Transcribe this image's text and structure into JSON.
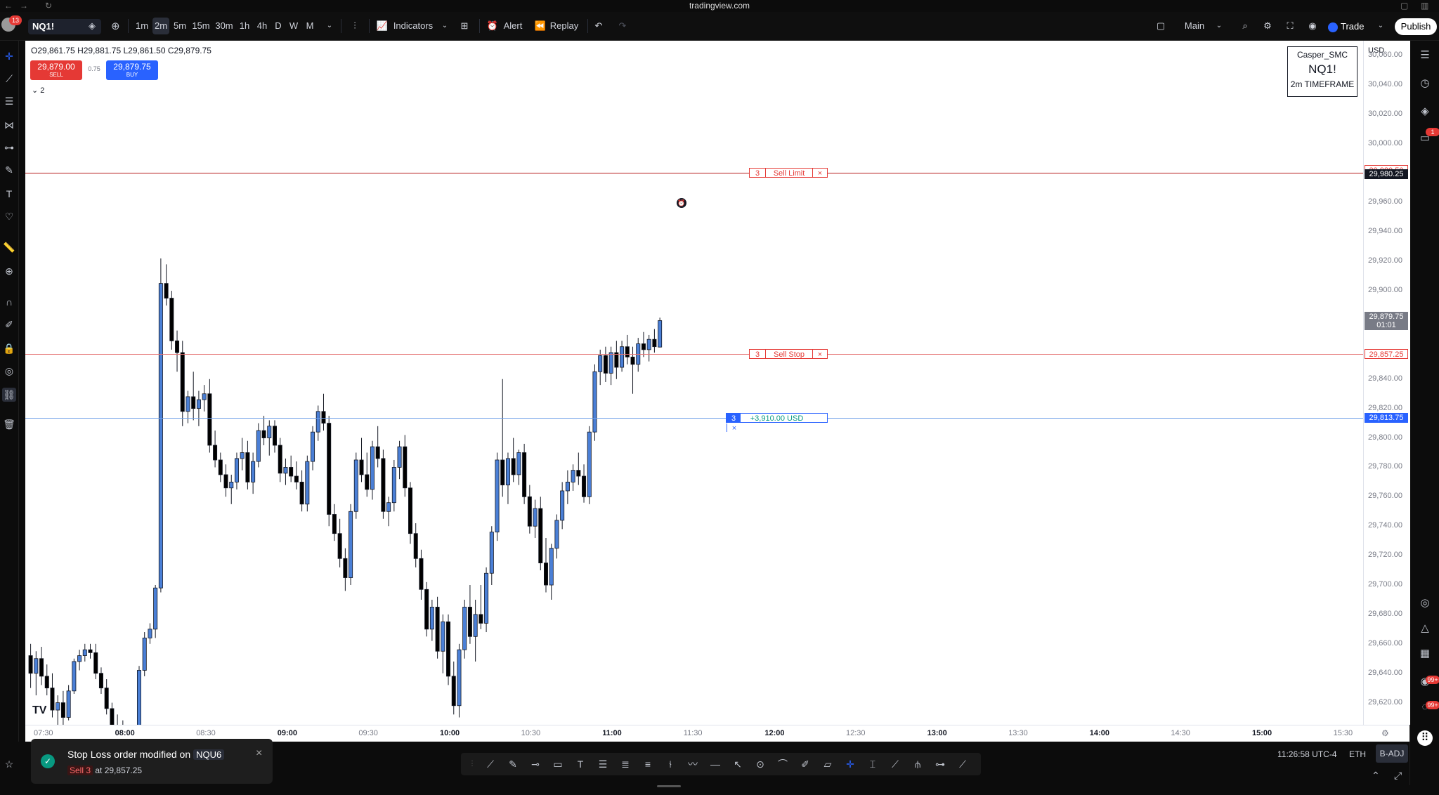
{
  "browser": {
    "url": "tradingview.com"
  },
  "toolbar": {
    "avatar_badge": "13",
    "symbol": "NQ1!",
    "intervals": [
      "1m",
      "2m",
      "5m",
      "15m",
      "30m",
      "1h",
      "4h",
      "D",
      "W",
      "M"
    ],
    "active_interval": "2m",
    "indicators_label": "Indicators",
    "alert_label": "Alert",
    "replay_label": "Replay",
    "layout_label": "Main",
    "trade_label": "Trade",
    "publish_label": "Publish"
  },
  "legend": {
    "open": "O29,861.75",
    "high": "H29,881.75",
    "low": "L29,861.50",
    "close": "C29,879.75",
    "sell_price": "29,879.00",
    "sell_label": "SELL",
    "spread": "0.75",
    "buy_price": "29,879.75",
    "buy_label": "BUY",
    "collapse_count": "2"
  },
  "info_box": {
    "user": "Casper_SMC",
    "symbol": "NQ1!",
    "timeframe": "2m TIMEFRAME"
  },
  "currency": "USD",
  "orders": {
    "sell_limit": {
      "qty": "3",
      "label": "Sell Limit",
      "price": 29980.5,
      "price_label": "29,980.50"
    },
    "sell_stop": {
      "qty": "3",
      "label": "Sell Stop",
      "price": 29857.25,
      "price_label": "29,857.25"
    },
    "position": {
      "qty": "3",
      "pnl": "+3,910.00 USD",
      "price": 29813.75,
      "price_label": "29,813.75"
    },
    "alert_line_price": 29980.25,
    "alert_line_label": "29,980.25",
    "last_price": 29879.75,
    "last_price_label": "29,879.75",
    "countdown": "01:01"
  },
  "chart_data": {
    "type": "candlestick",
    "y_axis": {
      "min": 29620,
      "max": 30060,
      "ticks": [
        30060,
        30040,
        30020,
        30000,
        29960,
        29940,
        29920,
        29900,
        29840,
        29820,
        29800,
        29780,
        29760,
        29740,
        29720,
        29700,
        29680,
        29660,
        29640,
        29620
      ],
      "tick_labels": [
        "30,060.00",
        "30,040.00",
        "30,020.00",
        "30,000.00",
        "29,960.00",
        "29,940.00",
        "29,920.00",
        "29,900.00",
        "29,840.00",
        "29,820.00",
        "29,800.00",
        "29,780.00",
        "29,760.00",
        "29,740.00",
        "29,720.00",
        "29,700.00",
        "29,680.00",
        "29,660.00",
        "29,640.00",
        "29,620.00"
      ]
    },
    "x_axis": {
      "labels": [
        "07:30",
        "08:00",
        "08:30",
        "09:00",
        "09:30",
        "10:00",
        "10:30",
        "11:00",
        "11:30",
        "12:00",
        "12:30",
        "13:00",
        "13:30",
        "14:00",
        "14:30",
        "15:00",
        "15:30"
      ],
      "major": [
        "08:00",
        "09:00",
        "10:00",
        "11:00",
        "12:00",
        "13:00",
        "14:00",
        "15:00"
      ]
    },
    "candles": [
      {
        "o": 29652,
        "h": 29660,
        "l": 29630,
        "c": 29640
      },
      {
        "o": 29640,
        "h": 29655,
        "l": 29625,
        "c": 29650
      },
      {
        "o": 29650,
        "h": 29658,
        "l": 29632,
        "c": 29638
      },
      {
        "o": 29638,
        "h": 29646,
        "l": 29625,
        "c": 29630
      },
      {
        "o": 29630,
        "h": 29640,
        "l": 29610,
        "c": 29615
      },
      {
        "o": 29615,
        "h": 29625,
        "l": 29600,
        "c": 29620
      },
      {
        "o": 29620,
        "h": 29628,
        "l": 29605,
        "c": 29610
      },
      {
        "o": 29610,
        "h": 29632,
        "l": 29608,
        "c": 29628
      },
      {
        "o": 29628,
        "h": 29650,
        "l": 29626,
        "c": 29648
      },
      {
        "o": 29648,
        "h": 29656,
        "l": 29642,
        "c": 29652
      },
      {
        "o": 29652,
        "h": 29660,
        "l": 29648,
        "c": 29656
      },
      {
        "o": 29656,
        "h": 29660,
        "l": 29650,
        "c": 29654
      },
      {
        "o": 29654,
        "h": 29660,
        "l": 29636,
        "c": 29640
      },
      {
        "o": 29640,
        "h": 29644,
        "l": 29626,
        "c": 29630
      },
      {
        "o": 29630,
        "h": 29636,
        "l": 29612,
        "c": 29616
      },
      {
        "o": 29616,
        "h": 29620,
        "l": 29598,
        "c": 29604
      },
      {
        "o": 29604,
        "h": 29612,
        "l": 29590,
        "c": 29600
      },
      {
        "o": 29600,
        "h": 29608,
        "l": 29585,
        "c": 29592
      },
      {
        "o": 29592,
        "h": 29598,
        "l": 29580,
        "c": 29590
      },
      {
        "o": 29590,
        "h": 29600,
        "l": 29585,
        "c": 29595
      },
      {
        "o": 29595,
        "h": 29645,
        "l": 29590,
        "c": 29642
      },
      {
        "o": 29642,
        "h": 29668,
        "l": 29638,
        "c": 29664
      },
      {
        "o": 29664,
        "h": 29674,
        "l": 29660,
        "c": 29670
      },
      {
        "o": 29670,
        "h": 29700,
        "l": 29664,
        "c": 29698
      },
      {
        "o": 29698,
        "h": 29922,
        "l": 29695,
        "c": 29905
      },
      {
        "o": 29905,
        "h": 29918,
        "l": 29890,
        "c": 29895
      },
      {
        "o": 29895,
        "h": 29900,
        "l": 29860,
        "c": 29866
      },
      {
        "o": 29866,
        "h": 29873,
        "l": 29845,
        "c": 29858
      },
      {
        "o": 29858,
        "h": 29866,
        "l": 29808,
        "c": 29818
      },
      {
        "o": 29818,
        "h": 29832,
        "l": 29810,
        "c": 29828
      },
      {
        "o": 29828,
        "h": 29845,
        "l": 29812,
        "c": 29820
      },
      {
        "o": 29820,
        "h": 29832,
        "l": 29808,
        "c": 29826
      },
      {
        "o": 29826,
        "h": 29836,
        "l": 29818,
        "c": 29830
      },
      {
        "o": 29830,
        "h": 29840,
        "l": 29790,
        "c": 29795
      },
      {
        "o": 29795,
        "h": 29805,
        "l": 29780,
        "c": 29785
      },
      {
        "o": 29785,
        "h": 29790,
        "l": 29770,
        "c": 29775
      },
      {
        "o": 29775,
        "h": 29782,
        "l": 29760,
        "c": 29766
      },
      {
        "o": 29766,
        "h": 29775,
        "l": 29755,
        "c": 29770
      },
      {
        "o": 29770,
        "h": 29790,
        "l": 29765,
        "c": 29786
      },
      {
        "o": 29786,
        "h": 29800,
        "l": 29778,
        "c": 29790
      },
      {
        "o": 29790,
        "h": 29798,
        "l": 29765,
        "c": 29770
      },
      {
        "o": 29770,
        "h": 29790,
        "l": 29762,
        "c": 29784
      },
      {
        "o": 29784,
        "h": 29810,
        "l": 29780,
        "c": 29805
      },
      {
        "o": 29805,
        "h": 29815,
        "l": 29795,
        "c": 29800
      },
      {
        "o": 29800,
        "h": 29812,
        "l": 29788,
        "c": 29808
      },
      {
        "o": 29808,
        "h": 29812,
        "l": 29790,
        "c": 29795
      },
      {
        "o": 29795,
        "h": 29800,
        "l": 29770,
        "c": 29776
      },
      {
        "o": 29776,
        "h": 29786,
        "l": 29768,
        "c": 29780
      },
      {
        "o": 29780,
        "h": 29788,
        "l": 29770,
        "c": 29774
      },
      {
        "o": 29774,
        "h": 29784,
        "l": 29765,
        "c": 29770
      },
      {
        "o": 29770,
        "h": 29778,
        "l": 29750,
        "c": 29755
      },
      {
        "o": 29755,
        "h": 29788,
        "l": 29750,
        "c": 29784
      },
      {
        "o": 29784,
        "h": 29808,
        "l": 29778,
        "c": 29804
      },
      {
        "o": 29804,
        "h": 29822,
        "l": 29798,
        "c": 29818
      },
      {
        "o": 29818,
        "h": 29830,
        "l": 29805,
        "c": 29810
      },
      {
        "o": 29810,
        "h": 29815,
        "l": 29740,
        "c": 29748
      },
      {
        "o": 29748,
        "h": 29755,
        "l": 29730,
        "c": 29735
      },
      {
        "o": 29735,
        "h": 29745,
        "l": 29712,
        "c": 29718
      },
      {
        "o": 29718,
        "h": 29725,
        "l": 29696,
        "c": 29705
      },
      {
        "o": 29705,
        "h": 29755,
        "l": 29700,
        "c": 29750
      },
      {
        "o": 29750,
        "h": 29790,
        "l": 29745,
        "c": 29785
      },
      {
        "o": 29785,
        "h": 29800,
        "l": 29770,
        "c": 29775
      },
      {
        "o": 29775,
        "h": 29790,
        "l": 29760,
        "c": 29765
      },
      {
        "o": 29765,
        "h": 29798,
        "l": 29758,
        "c": 29794
      },
      {
        "o": 29794,
        "h": 29808,
        "l": 29780,
        "c": 29786
      },
      {
        "o": 29786,
        "h": 29792,
        "l": 29745,
        "c": 29750
      },
      {
        "o": 29750,
        "h": 29760,
        "l": 29740,
        "c": 29756
      },
      {
        "o": 29756,
        "h": 29785,
        "l": 29750,
        "c": 29780
      },
      {
        "o": 29780,
        "h": 29798,
        "l": 29772,
        "c": 29794
      },
      {
        "o": 29794,
        "h": 29802,
        "l": 29760,
        "c": 29766
      },
      {
        "o": 29766,
        "h": 29770,
        "l": 29728,
        "c": 29735
      },
      {
        "o": 29735,
        "h": 29742,
        "l": 29712,
        "c": 29718
      },
      {
        "o": 29718,
        "h": 29724,
        "l": 29690,
        "c": 29697
      },
      {
        "o": 29697,
        "h": 29702,
        "l": 29665,
        "c": 29670
      },
      {
        "o": 29670,
        "h": 29690,
        "l": 29662,
        "c": 29685
      },
      {
        "o": 29685,
        "h": 29692,
        "l": 29650,
        "c": 29655
      },
      {
        "o": 29655,
        "h": 29680,
        "l": 29640,
        "c": 29675
      },
      {
        "o": 29675,
        "h": 29680,
        "l": 29632,
        "c": 29638
      },
      {
        "o": 29638,
        "h": 29648,
        "l": 29612,
        "c": 29618
      },
      {
        "o": 29618,
        "h": 29660,
        "l": 29610,
        "c": 29656
      },
      {
        "o": 29656,
        "h": 29690,
        "l": 29650,
        "c": 29685
      },
      {
        "o": 29685,
        "h": 29700,
        "l": 29660,
        "c": 29665
      },
      {
        "o": 29665,
        "h": 29690,
        "l": 29648,
        "c": 29680
      },
      {
        "o": 29680,
        "h": 29700,
        "l": 29670,
        "c": 29674
      },
      {
        "o": 29674,
        "h": 29712,
        "l": 29668,
        "c": 29708
      },
      {
        "o": 29708,
        "h": 29740,
        "l": 29700,
        "c": 29736
      },
      {
        "o": 29736,
        "h": 29790,
        "l": 29730,
        "c": 29785
      },
      {
        "o": 29785,
        "h": 29840,
        "l": 29760,
        "c": 29768
      },
      {
        "o": 29768,
        "h": 29790,
        "l": 29755,
        "c": 29786
      },
      {
        "o": 29786,
        "h": 29800,
        "l": 29770,
        "c": 29775
      },
      {
        "o": 29775,
        "h": 29792,
        "l": 29768,
        "c": 29790
      },
      {
        "o": 29790,
        "h": 29796,
        "l": 29755,
        "c": 29760
      },
      {
        "o": 29760,
        "h": 29768,
        "l": 29735,
        "c": 29740
      },
      {
        "o": 29740,
        "h": 29758,
        "l": 29732,
        "c": 29752
      },
      {
        "o": 29752,
        "h": 29760,
        "l": 29710,
        "c": 29715
      },
      {
        "o": 29715,
        "h": 29732,
        "l": 29695,
        "c": 29700
      },
      {
        "o": 29700,
        "h": 29728,
        "l": 29690,
        "c": 29725
      },
      {
        "o": 29725,
        "h": 29748,
        "l": 29718,
        "c": 29744
      },
      {
        "o": 29744,
        "h": 29770,
        "l": 29738,
        "c": 29764
      },
      {
        "o": 29764,
        "h": 29778,
        "l": 29755,
        "c": 29770
      },
      {
        "o": 29770,
        "h": 29782,
        "l": 29764,
        "c": 29778
      },
      {
        "o": 29778,
        "h": 29790,
        "l": 29768,
        "c": 29774
      },
      {
        "o": 29774,
        "h": 29782,
        "l": 29756,
        "c": 29760
      },
      {
        "o": 29760,
        "h": 29808,
        "l": 29755,
        "c": 29804
      },
      {
        "o": 29804,
        "h": 29850,
        "l": 29798,
        "c": 29845
      },
      {
        "o": 29845,
        "h": 29860,
        "l": 29836,
        "c": 29856
      },
      {
        "o": 29856,
        "h": 29862,
        "l": 29838,
        "c": 29844
      },
      {
        "o": 29844,
        "h": 29862,
        "l": 29836,
        "c": 29858
      },
      {
        "o": 29858,
        "h": 29866,
        "l": 29840,
        "c": 29848
      },
      {
        "o": 29848,
        "h": 29866,
        "l": 29845,
        "c": 29862
      },
      {
        "o": 29862,
        "h": 29870,
        "l": 29850,
        "c": 29855
      },
      {
        "o": 29855,
        "h": 29862,
        "l": 29830,
        "c": 29850
      },
      {
        "o": 29850,
        "h": 29868,
        "l": 29845,
        "c": 29864
      },
      {
        "o": 29864,
        "h": 29872,
        "l": 29855,
        "c": 29860
      },
      {
        "o": 29860,
        "h": 29870,
        "l": 29852,
        "c": 29867
      },
      {
        "o": 29867,
        "h": 29874,
        "l": 29858,
        "c": 29862
      },
      {
        "o": 29861.75,
        "h": 29881.75,
        "l": 29861.5,
        "c": 29879.75
      }
    ]
  }
}
